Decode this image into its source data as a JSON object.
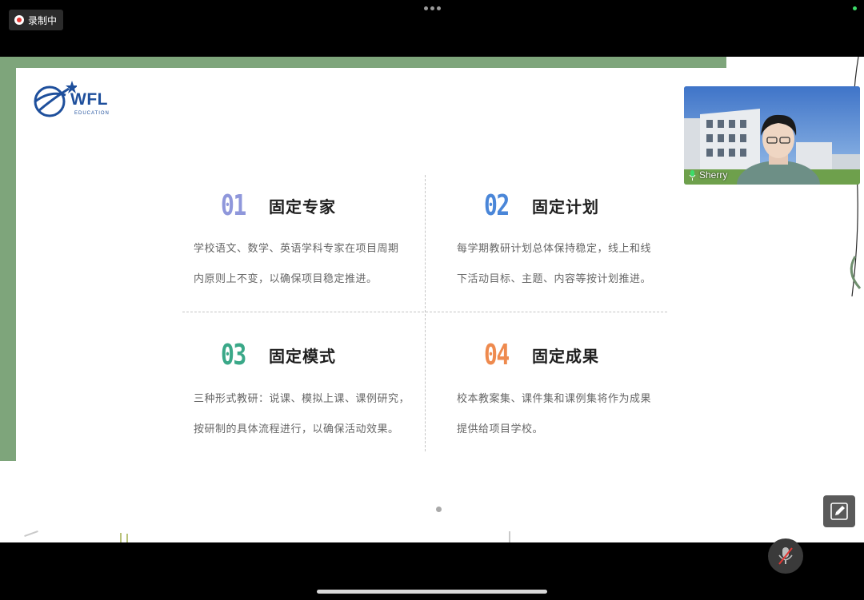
{
  "recording": {
    "label": "录制中"
  },
  "slide": {
    "logo": {
      "text": "WFL",
      "sub": "EDUCATION"
    },
    "quadrants": [
      {
        "num": "01",
        "color": "#8f97db",
        "title": "固定专家",
        "lines": [
          "学校语文、数学、英语学科专家在项目周期",
          "内原则上不变，以确保项目稳定推进。"
        ]
      },
      {
        "num": "02",
        "color": "#4a86d8",
        "title": "固定计划",
        "lines": [
          "每学期教研计划总体保持稳定，线上和线",
          "下活动目标、主题、内容等按计划推进。"
        ]
      },
      {
        "num": "03",
        "color": "#3aa888",
        "title": "固定模式",
        "lines": [
          "三种形式教研：说课、模拟上课、课例研究，",
          "按研制的具体流程进行，以确保活动效果。"
        ]
      },
      {
        "num": "04",
        "color": "#ee8a4e",
        "title": "固定成果",
        "lines": [
          "校本教案集、课件集和课例集将作为成果",
          "提供给项目学校。"
        ]
      }
    ]
  },
  "video": {
    "participant": "Sherry"
  },
  "colors": {
    "accent_green": "#7ea57b",
    "brand_blue": "#1e4f9c"
  }
}
